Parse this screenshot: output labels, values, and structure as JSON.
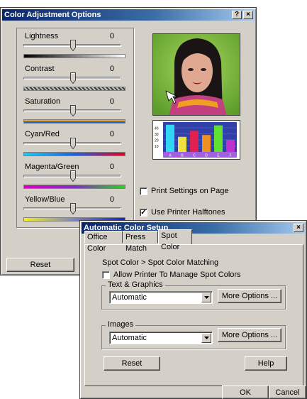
{
  "color_dialog": {
    "title": "Color Adjustment Options",
    "help_btn": "?",
    "close_btn": "×",
    "sliders": [
      {
        "label": "Lightness",
        "value": "0"
      },
      {
        "label": "Contrast",
        "value": "0"
      },
      {
        "label": "Saturation",
        "value": "0"
      },
      {
        "label": "Cyan/Red",
        "value": "0"
      },
      {
        "label": "Magenta/Green",
        "value": "0"
      },
      {
        "label": "Yellow/Blue",
        "value": "0"
      }
    ],
    "checkboxes": [
      {
        "label": "Print Settings on Page",
        "checked": false
      },
      {
        "label": "Use Printer Halftones",
        "checked": true
      }
    ],
    "reset_label": "Reset",
    "preview_chart": {
      "ticks": [
        "40",
        "30",
        "20",
        "10"
      ],
      "bars": [
        {
          "label": "A",
          "value": 45,
          "color": "#33d6f5"
        },
        {
          "label": "B",
          "value": 25,
          "color": "#f0e040"
        },
        {
          "label": "C",
          "value": 35,
          "color": "#e02050"
        },
        {
          "label": "D",
          "value": 28,
          "color": "#f09020"
        },
        {
          "label": "E",
          "value": 44,
          "color": "#60e030"
        },
        {
          "label": "F",
          "value": 20,
          "color": "#c030d0"
        }
      ]
    }
  },
  "auto_dialog": {
    "title": "Automatic Color Setup",
    "close_btn": "×",
    "tabs": [
      {
        "label": "Office Color",
        "active": false
      },
      {
        "label": "Press Match",
        "active": false
      },
      {
        "label": "Spot Color",
        "active": true
      }
    ],
    "subtitle": "Spot Color > Spot Color Matching",
    "allow_checkbox": {
      "label": "Allow Printer To Manage Spot Colors",
      "checked": false
    },
    "groups": [
      {
        "title": "Text & Graphics",
        "value": "Automatic",
        "button": "More Options ..."
      },
      {
        "title": "Images",
        "value": "Automatic",
        "button": "More Options ..."
      }
    ],
    "reset_label": "Reset",
    "help_label": "Help",
    "ok_label": "OK",
    "cancel_label": "Cancel"
  }
}
